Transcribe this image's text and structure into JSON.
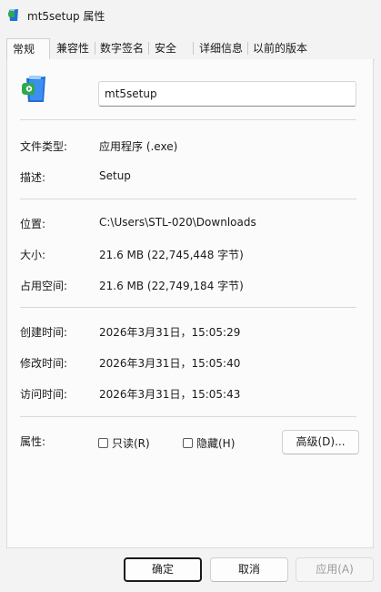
{
  "window": {
    "title": "mt5setup 属性"
  },
  "tabs": [
    {
      "label": "常规",
      "active": true
    },
    {
      "label": "兼容性"
    },
    {
      "label": "数字签名"
    },
    {
      "label": "安全"
    },
    {
      "label": "详细信息"
    },
    {
      "label": "以前的版本"
    }
  ],
  "file": {
    "name": "mt5setup"
  },
  "info": {
    "type_label": "文件类型:",
    "type_value": "应用程序 (.exe)",
    "desc_label": "描述:",
    "desc_value": "Setup",
    "location_label": "位置:",
    "location_value": "C:\\Users\\STL-020\\Downloads",
    "size_label": "大小:",
    "size_value": "21.6 MB (22,745,448 字节)",
    "disk_label": "占用空间:",
    "disk_value": "21.6 MB (22,749,184 字节)",
    "created_label": "创建时间:",
    "created_value": "2026年3月31日，15:05:29",
    "modified_label": "修改时间:",
    "modified_value": "2026年3月31日，15:05:40",
    "accessed_label": "访问时间:",
    "accessed_value": "2026年3月31日，15:05:43"
  },
  "attributes": {
    "label": "属性:",
    "readonly": "只读(R)",
    "readonly_checked": false,
    "hidden": "隐藏(H)",
    "hidden_checked": false,
    "advanced": "高级(D)..."
  },
  "buttons": {
    "ok": "确定",
    "cancel": "取消",
    "apply": "应用(A)"
  },
  "colors": {
    "window_bg": "#f3f3f3",
    "panel_bg": "#fbfbfb",
    "icon_blue": "#1e6fd9",
    "icon_green": "#2fa84f"
  }
}
